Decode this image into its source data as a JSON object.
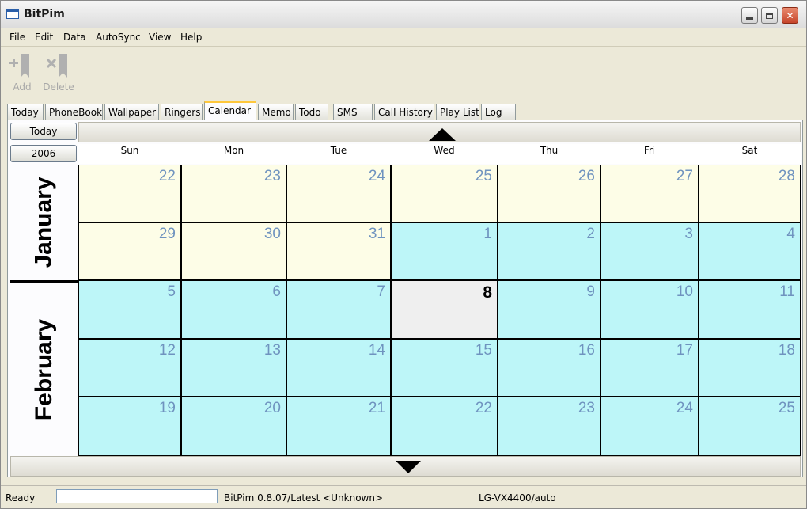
{
  "window": {
    "title": "BitPim"
  },
  "menu": [
    "File",
    "Edit",
    "Data",
    "AutoSync",
    "View",
    "Help"
  ],
  "toolbar": {
    "add_label": "Add",
    "delete_label": "Delete"
  },
  "tabs": [
    "Today",
    "PhoneBook",
    "Wallpaper",
    "Ringers",
    "Calendar",
    "Memo",
    "Todo",
    "SMS",
    "Call History",
    "Play List",
    "Log"
  ],
  "active_tab": "Calendar",
  "calendar": {
    "today_button": "Today",
    "year_button": "2006",
    "weekdays": [
      "Sun",
      "Mon",
      "Tue",
      "Wed",
      "Thu",
      "Fri",
      "Sat"
    ],
    "months": [
      "January",
      "February"
    ],
    "weeks": [
      [
        "22",
        "23",
        "24",
        "25",
        "26",
        "27",
        "28"
      ],
      [
        "29",
        "30",
        "31",
        "1",
        "2",
        "3",
        "4"
      ],
      [
        "5",
        "6",
        "7",
        "8",
        "9",
        "10",
        "11"
      ],
      [
        "12",
        "13",
        "14",
        "15",
        "16",
        "17",
        "18"
      ],
      [
        "19",
        "20",
        "21",
        "22",
        "23",
        "24",
        "25"
      ]
    ],
    "today_day": "8",
    "colors": {
      "january_cell": "#fdfde7",
      "february_cell": "#bdf6f8",
      "today_cell": "#efefef",
      "day_number": "#6f93bf"
    }
  },
  "status": {
    "state": "Ready",
    "version": "BitPim 0.8.07/Latest <Unknown>",
    "phone": "LG-VX4400/auto"
  },
  "icons": {
    "add": "plus-bookmark-icon",
    "delete": "x-bookmark-icon",
    "scroll_up": "triangle-up-icon",
    "scroll_down": "triangle-down-icon"
  }
}
